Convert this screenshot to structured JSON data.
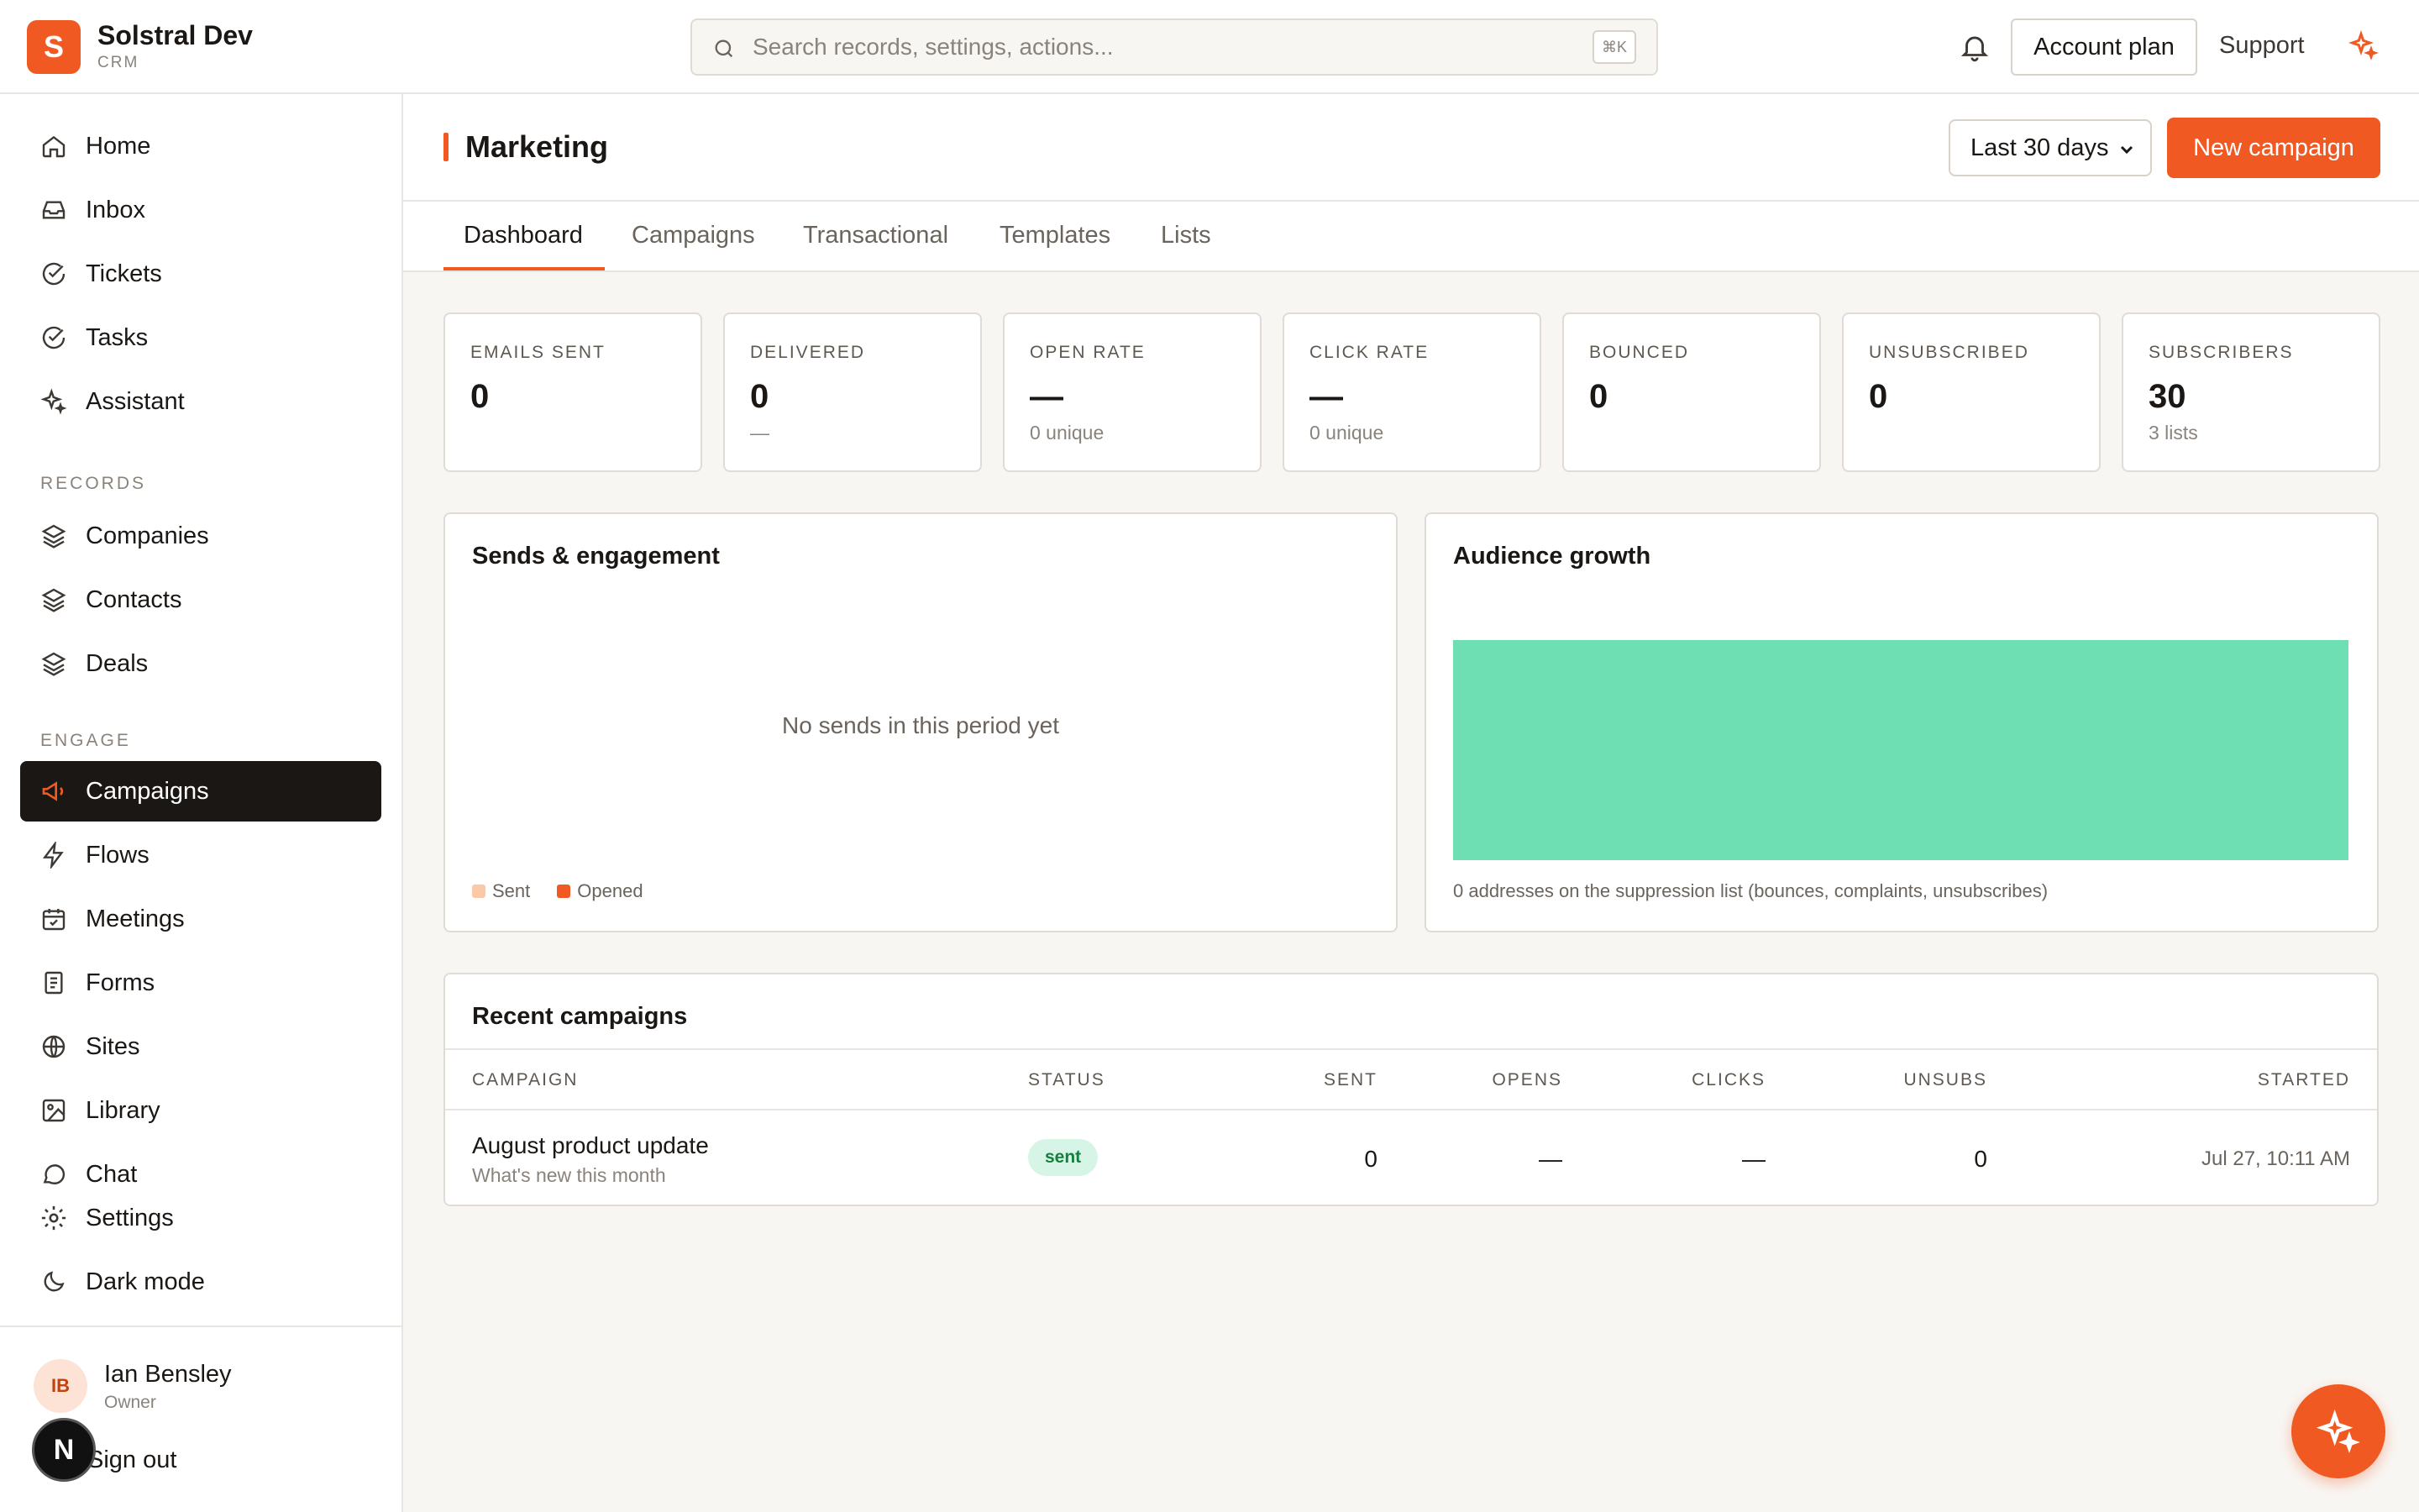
{
  "brand": {
    "name": "Solstral Dev",
    "sub": "CRM",
    "logo_letter": "S",
    "accent": "#f05a22"
  },
  "search": {
    "placeholder": "Search records, settings, actions...",
    "shortcut": "⌘K"
  },
  "topbar": {
    "account_label": "Account plan",
    "support_label": "Support"
  },
  "sidebar": {
    "main": [
      {
        "label": "Home",
        "icon": "home-icon"
      },
      {
        "label": "Inbox",
        "icon": "inbox-icon"
      },
      {
        "label": "Tickets",
        "icon": "check-circle-icon"
      },
      {
        "label": "Tasks",
        "icon": "check-circle-icon"
      },
      {
        "label": "Assistant",
        "icon": "sparkle-icon"
      }
    ],
    "records_label": "RECORDS",
    "records": [
      {
        "label": "Companies",
        "icon": "layers-icon"
      },
      {
        "label": "Contacts",
        "icon": "layers-icon"
      },
      {
        "label": "Deals",
        "icon": "layers-icon"
      }
    ],
    "engage_label": "ENGAGE",
    "engage": [
      {
        "label": "Campaigns",
        "icon": "megaphone-icon",
        "active": true
      },
      {
        "label": "Flows",
        "icon": "bolt-icon"
      },
      {
        "label": "Meetings",
        "icon": "calendar-icon"
      },
      {
        "label": "Forms",
        "icon": "form-icon"
      },
      {
        "label": "Sites",
        "icon": "globe-icon"
      },
      {
        "label": "Library",
        "icon": "image-icon"
      },
      {
        "label": "Chat",
        "icon": "chat-icon"
      }
    ],
    "settings_label": "Settings",
    "darkmode_label": "Dark mode",
    "user": {
      "initials": "IB",
      "name": "Ian Bensley",
      "role": "Owner"
    },
    "signout_label": "Sign out",
    "n_badge": "N"
  },
  "page": {
    "title": "Marketing",
    "range": "Last 30 days",
    "new_campaign_label": "New campaign",
    "tabs": [
      "Dashboard",
      "Campaigns",
      "Transactional",
      "Templates",
      "Lists"
    ]
  },
  "stats": [
    {
      "label": "EMAILS SENT",
      "value": "0",
      "sub": ""
    },
    {
      "label": "DELIVERED",
      "value": "0",
      "sub": "—"
    },
    {
      "label": "OPEN RATE",
      "value": "—",
      "sub": "0 unique"
    },
    {
      "label": "CLICK RATE",
      "value": "—",
      "sub": "0 unique"
    },
    {
      "label": "BOUNCED",
      "value": "0",
      "sub": ""
    },
    {
      "label": "UNSUBSCRIBED",
      "value": "0",
      "sub": ""
    },
    {
      "label": "SUBSCRIBERS",
      "value": "30",
      "sub": "3 lists"
    }
  ],
  "sends": {
    "title": "Sends & engagement",
    "empty": "No sends in this period yet",
    "legend": [
      {
        "name": "Sent",
        "color": "#fbc9a8"
      },
      {
        "name": "Opened",
        "color": "#f05a22"
      }
    ]
  },
  "growth": {
    "title": "Audience growth",
    "note": "0 addresses on the suppression list (bounces, complaints, unsubscribes)",
    "color": "#6edfb3"
  },
  "recent": {
    "title": "Recent campaigns",
    "columns": [
      "CAMPAIGN",
      "STATUS",
      "SENT",
      "OPENS",
      "CLICKS",
      "UNSUBS",
      "STARTED"
    ],
    "rows": [
      {
        "name": "August product update",
        "subject": "What's new this month",
        "status": "sent",
        "sent": "0",
        "opens": "—",
        "clicks": "—",
        "unsubs": "0",
        "started": "Jul 27, 10:11 AM"
      }
    ]
  }
}
